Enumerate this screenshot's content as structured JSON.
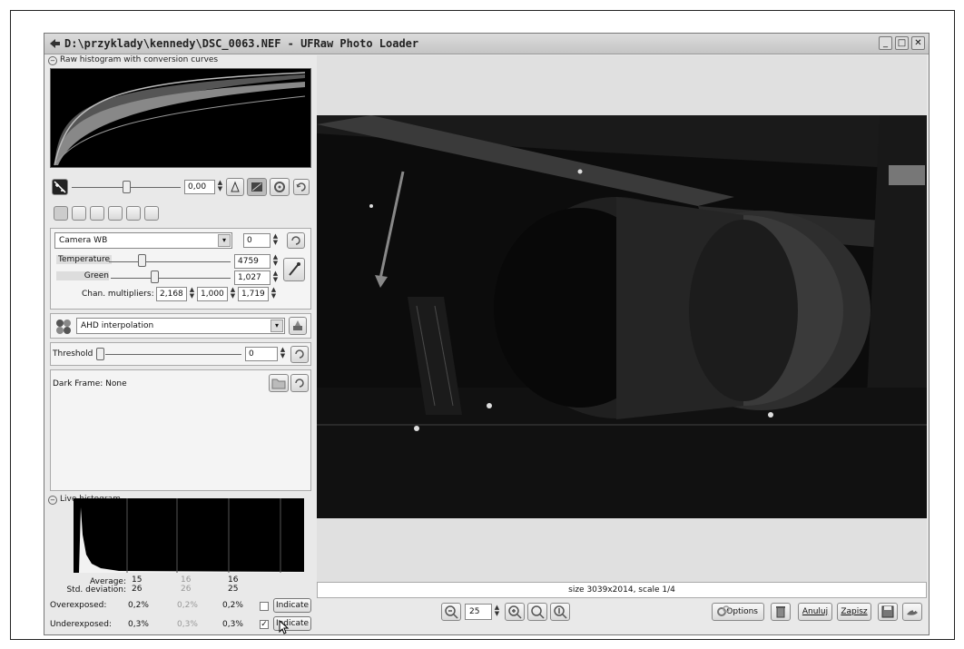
{
  "window": {
    "title": "D:\\przyklady\\kennedy\\DSC_0063.NEF - UFRaw Photo Loader",
    "controls": [
      "minimize",
      "maximize",
      "close"
    ]
  },
  "raw_histogram": {
    "label": "Raw histogram with conversion curves"
  },
  "exposure": {
    "value": "0,00",
    "icons": [
      "exposure-icon",
      "clipping-icon",
      "auto-exposure-icon",
      "gear-icon",
      "reset-icon"
    ]
  },
  "tabs": [
    "white-balance-tab",
    "grayscale-tab",
    "base-curve-tab",
    "color-tab",
    "correction-tab",
    "exif-tab"
  ],
  "white_balance": {
    "preset": "Camera WB",
    "fine_tune": "0",
    "temperature_label": "Temperature",
    "temperature_value": "4759",
    "green_label": "Green",
    "green_value": "1,027",
    "chan_multipliers_label": "Chan. multipliers:",
    "chan_multipliers": [
      "2,168",
      "1,000",
      "1,719"
    ]
  },
  "interpolation": {
    "value": "AHD interpolation"
  },
  "threshold": {
    "label": "Threshold",
    "value": "0"
  },
  "dark_frame": {
    "label": "Dark Frame:",
    "value": "None"
  },
  "live_histogram": {
    "label": "Live histogram",
    "average_label": "Average:",
    "average": [
      "15",
      "16",
      "16"
    ],
    "stddev_label": "Std. deviation:",
    "stddev": [
      "26",
      "26",
      "25"
    ],
    "overexposed_label": "Overexposed:",
    "overexposed": [
      "0,2%",
      "0,2%",
      "0,2%"
    ],
    "overexposed_checked": false,
    "underexposed_label": "Underexposed:",
    "underexposed": [
      "0,3%",
      "0,3%",
      "0,3%"
    ],
    "underexposed_checked": true,
    "indicate_label": "Indicate"
  },
  "status": {
    "text": "size 3039x2014, scale 1/4"
  },
  "toolbar": {
    "zoom_value": "25",
    "options_label": "Options",
    "cancel_label": "Anuluj",
    "save_label": "Zapisz"
  },
  "colors": {
    "window_bg": "#e9e9e9",
    "histogram_bg": "#000000",
    "photo_bg": "#0a0a0a"
  }
}
